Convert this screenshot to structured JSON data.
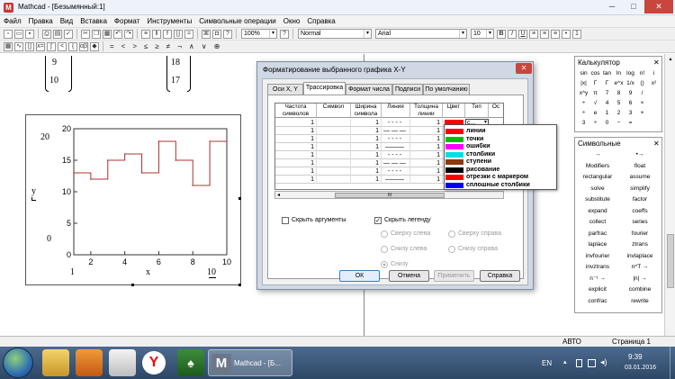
{
  "window": {
    "title": "Mathcad - [Безымянный:1]",
    "minimize": "─",
    "maximize": "□",
    "close": "✕"
  },
  "menu": [
    "Файл",
    "Правка",
    "Вид",
    "Вставка",
    "Формат",
    "Инструменты",
    "Символьные операции",
    "Окно",
    "Справка"
  ],
  "toolbar": {
    "zoom": "100%",
    "style": "Normal",
    "font": "Arial",
    "size": "10"
  },
  "matrices": {
    "m1": [
      "9",
      "10"
    ],
    "m2": [
      "18",
      "17"
    ]
  },
  "graph": {
    "y_max": "20",
    "y_zero": "0",
    "y_label": "y",
    "x_min": "1",
    "x_label": "x",
    "x_max": "10"
  },
  "chart_data": {
    "type": "line",
    "x": [
      1,
      2,
      3,
      4,
      5,
      6,
      7,
      8,
      9,
      10
    ],
    "y": [
      13,
      12,
      15,
      16,
      13,
      18,
      15,
      11,
      18,
      18
    ],
    "xlim": [
      1,
      10
    ],
    "ylim": [
      0,
      20
    ],
    "xticks": [
      "2",
      "4",
      "6",
      "8",
      "10"
    ],
    "yticks": [
      "0",
      "5",
      "10",
      "15",
      "20"
    ],
    "line_color": "#b03030",
    "step": true
  },
  "dialog": {
    "title": "Форматирование выбранного графика X-Y",
    "close": "✕",
    "tabs": [
      "Оси X, Y",
      "Трассировка",
      "Формат числа",
      "Подписи",
      "По умолчанию"
    ],
    "columns": [
      "Частота символов",
      "Символ",
      "Ширина символа",
      "Линия",
      "Толщина линии",
      "Цвет",
      "Тип",
      "Ос"
    ],
    "rows": [
      {
        "freq": "1",
        "width": "1",
        "line": "- - - -",
        "thick": "1"
      },
      {
        "freq": "1",
        "width": "1",
        "line": "— — —",
        "thick": "1"
      },
      {
        "freq": "1",
        "width": "1",
        "line": "- - - -",
        "thick": "1"
      },
      {
        "freq": "1",
        "width": "1",
        "line": "———",
        "thick": "1"
      },
      {
        "freq": "1",
        "width": "1",
        "line": "- - - -",
        "thick": "1"
      },
      {
        "freq": "1",
        "width": "1",
        "line": "— — —",
        "thick": "1"
      },
      {
        "freq": "1",
        "width": "1",
        "line": "- - - -",
        "thick": "1"
      },
      {
        "freq": "1",
        "width": "1",
        "line": "———",
        "thick": "1"
      }
    ],
    "type_cell": "с...",
    "scroll_mark": "III",
    "scroll_left": "◂",
    "hide_args": "Скрыть аргументы",
    "hide_legend": "Скрыть легенду",
    "legend_pos": [
      "Сверху слева",
      "Сверху справа",
      "Снизу слева",
      "Снизу справа",
      "Снизу"
    ],
    "buttons": {
      "ok": "ОК",
      "cancel": "Отмена",
      "apply": "Применить",
      "help": "Справка"
    }
  },
  "color_dropdown": [
    {
      "label": "линии",
      "color": "#ff0000"
    },
    {
      "label": "точки",
      "color": "#00c000"
    },
    {
      "label": "ошибки",
      "color": "#ff00ff"
    },
    {
      "label": "столбики",
      "color": "#00e0e0"
    },
    {
      "label": "ступени",
      "color": "#8b3a10"
    },
    {
      "label": "рисование",
      "color": "#000000"
    },
    {
      "label": "отрезки с маркером",
      "color": "#ff0000"
    },
    {
      "label": "сплошные столбики",
      "color": "#0000ff"
    }
  ],
  "calculator": {
    "title": "Калькулятор",
    "close": "✕",
    "rows": [
      [
        "sin",
        "cos",
        "tan",
        "ln",
        "log",
        "n!",
        "i"
      ],
      [
        "|x|",
        "Γ",
        "Γ",
        "e^x",
        "1/x",
        "()",
        "x²"
      ],
      [
        "x^y",
        "π",
        "7",
        "8",
        "9",
        "/",
        ""
      ],
      [
        "÷",
        "√",
        "4",
        "5",
        "6",
        "×",
        ""
      ],
      [
        "÷",
        "e",
        "1",
        "2",
        "3",
        "+",
        ""
      ],
      [
        "3",
        "÷",
        "0",
        "−",
        "=",
        "",
        ""
      ]
    ]
  },
  "symbolic": {
    "title": "Символьные",
    "close": "✕",
    "items": [
      [
        "→",
        "•→"
      ],
      [
        "Modifiers",
        "float"
      ],
      [
        "rectangular",
        "assume"
      ],
      [
        "solve",
        "simplify"
      ],
      [
        "substitute",
        "factor"
      ],
      [
        "expand",
        "coeffs"
      ],
      [
        "collect",
        "series"
      ],
      [
        "parfrac",
        "fourier"
      ],
      [
        "laplace",
        "ztrans"
      ],
      [
        "invfourier",
        "invlaplace"
      ],
      [
        "invztrans",
        "n^T →"
      ],
      [
        "n⁻¹ →",
        "|n| →"
      ],
      [
        "explicit",
        "combine"
      ],
      [
        "confrac",
        "rewrite"
      ]
    ]
  },
  "status": {
    "mode": "АВТО",
    "page": "Страница 1"
  },
  "taskbar": {
    "task": "Mathcad - [Б...",
    "lang": "EN",
    "time": "9:39",
    "date": "03.01.2016"
  }
}
